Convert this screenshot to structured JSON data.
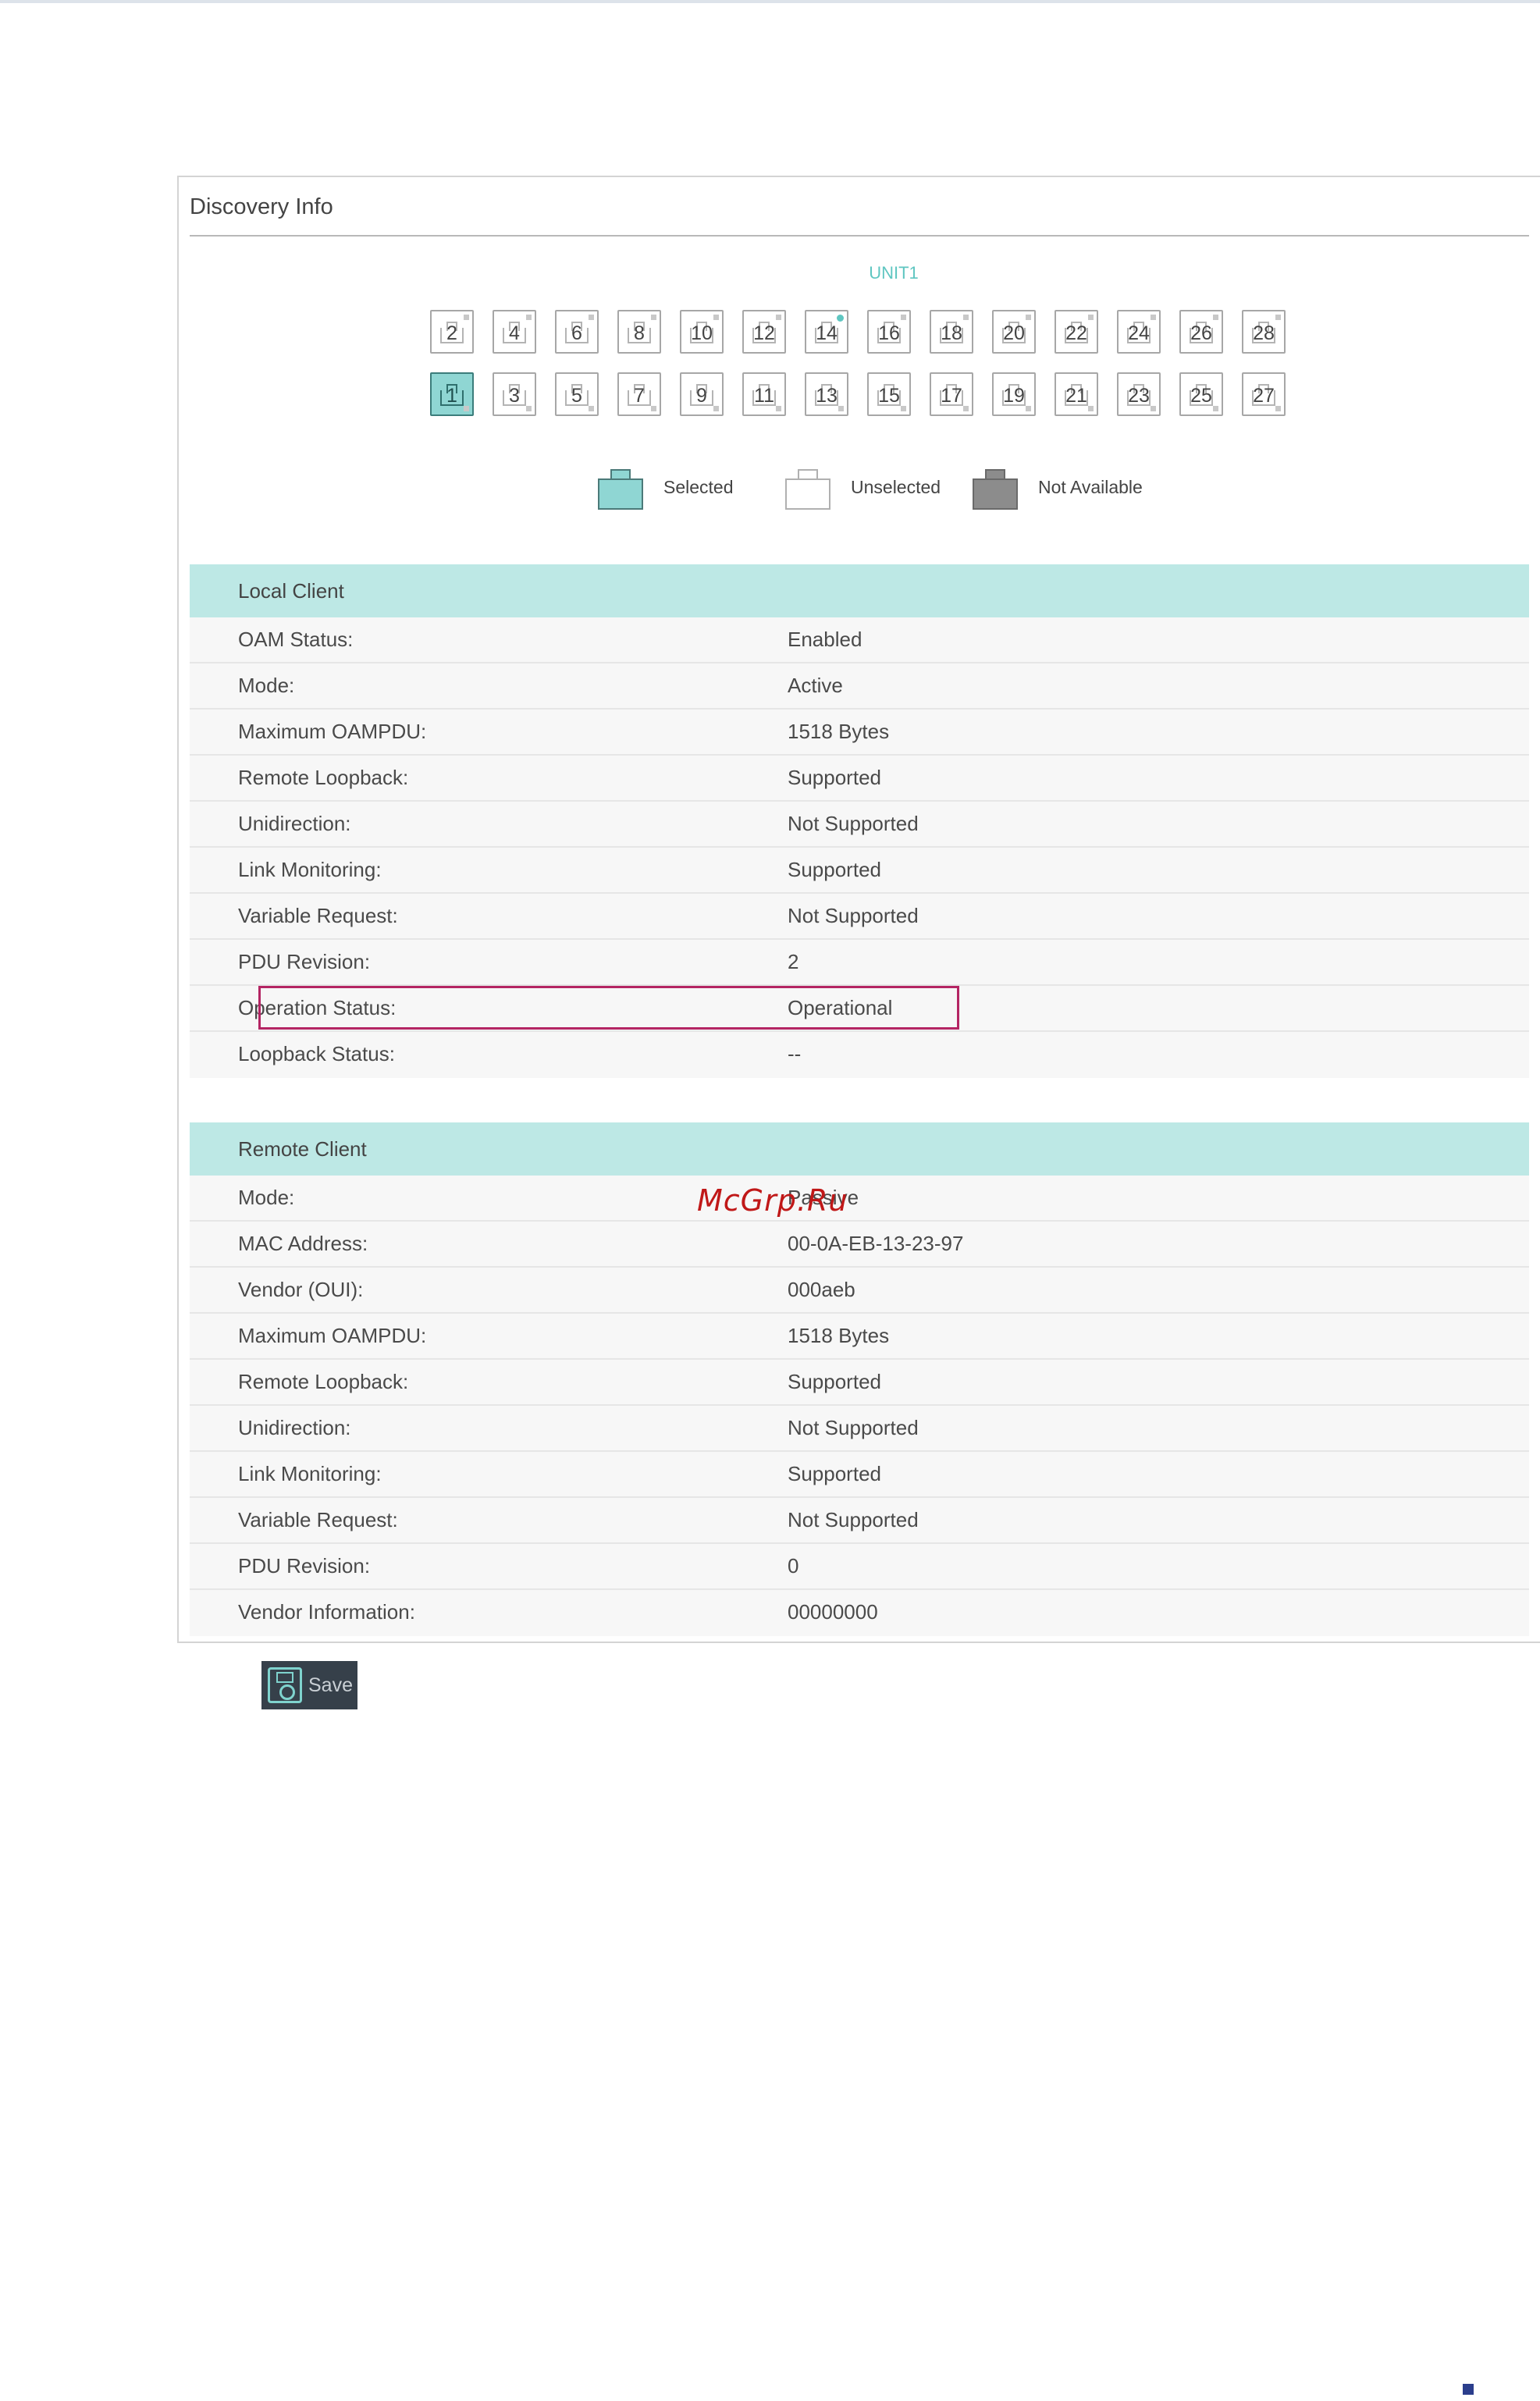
{
  "panel": {
    "title": "Discovery Info",
    "unit_label": "UNIT1"
  },
  "ports": {
    "top_row": [
      "2",
      "4",
      "6",
      "8",
      "10",
      "12",
      "14",
      "16",
      "18",
      "20",
      "22",
      "24",
      "26",
      "28"
    ],
    "bottom_row": [
      "1",
      "3",
      "5",
      "7",
      "9",
      "11",
      "13",
      "15",
      "17",
      "19",
      "21",
      "23",
      "25",
      "27"
    ],
    "selected": "1",
    "link_up": [
      "14"
    ]
  },
  "legend": {
    "selected": "Selected",
    "unselected": "Unselected",
    "not_available": "Not Available"
  },
  "local_client": {
    "heading": "Local Client",
    "rows": [
      {
        "key": "OAM Status:",
        "value": "Enabled"
      },
      {
        "key": "Mode:",
        "value": "Active"
      },
      {
        "key": "Maximum OAMPDU:",
        "value": "1518 Bytes"
      },
      {
        "key": "Remote Loopback:",
        "value": "Supported"
      },
      {
        "key": "Unidirection:",
        "value": "Not Supported"
      },
      {
        "key": "Link Monitoring:",
        "value": "Supported"
      },
      {
        "key": "Variable Request:",
        "value": "Not Supported"
      },
      {
        "key": "PDU Revision:",
        "value": "2"
      },
      {
        "key": "Operation Status:",
        "value": "Operational"
      },
      {
        "key": "Loopback Status:",
        "value": "--"
      }
    ]
  },
  "remote_client": {
    "heading": "Remote Client",
    "rows": [
      {
        "key": "Mode:",
        "value": "Passive"
      },
      {
        "key": "MAC Address:",
        "value": "00-0A-EB-13-23-97"
      },
      {
        "key": "Vendor (OUI):",
        "value": "000aeb"
      },
      {
        "key": "Maximum OAMPDU:",
        "value": "1518 Bytes"
      },
      {
        "key": "Remote Loopback:",
        "value": "Supported"
      },
      {
        "key": "Unidirection:",
        "value": "Not Supported"
      },
      {
        "key": "Link Monitoring:",
        "value": "Supported"
      },
      {
        "key": "Variable Request:",
        "value": "Not Supported"
      },
      {
        "key": "PDU Revision:",
        "value": "0"
      },
      {
        "key": "Vendor Information:",
        "value": "00000000"
      }
    ]
  },
  "watermark": "McGrp.Ru",
  "save_label": "Save",
  "colors": {
    "accent": "#5fc6c1",
    "section_header": "#bde8e5",
    "highlight": "#b42563",
    "button_bg": "#36404a"
  }
}
